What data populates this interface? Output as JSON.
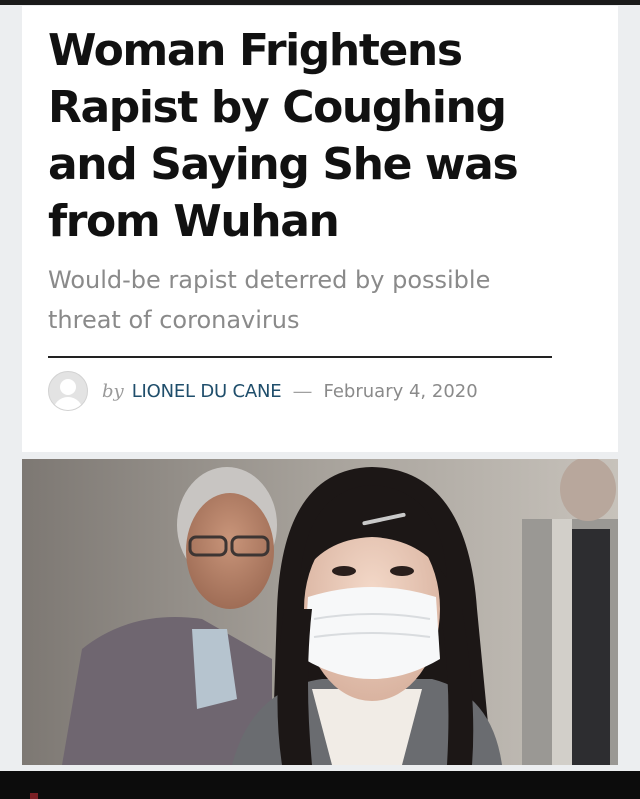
{
  "article": {
    "headline": "Woman Frightens Rapist by Coughing and Saying She was from Wuhan",
    "subheadline": "Would-be rapist deterred by possible threat of coronavirus",
    "byline": {
      "prefix": "by",
      "author": "LIONEL DU CANE",
      "separator": "—",
      "date": "February 4, 2020"
    }
  },
  "colors": {
    "headline": "#111111",
    "subheadline": "#8a8a8a",
    "author_link": "#1f4e6b",
    "background": "#eceef0"
  },
  "icons": {
    "author_avatar": "user-avatar-icon"
  }
}
